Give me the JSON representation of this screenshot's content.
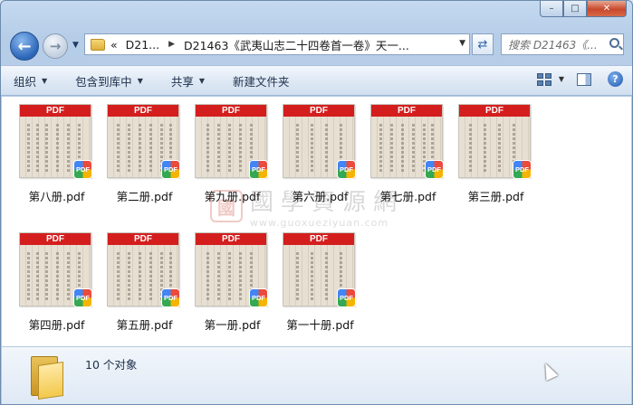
{
  "window": {
    "caption": {
      "minimize": "–",
      "maximize": "□",
      "close": "✕"
    }
  },
  "nav": {
    "address": {
      "overflow": "«",
      "crumbs": [
        "D21...",
        "D21463《武夷山志二十四卷首一卷》天一..."
      ]
    },
    "search_placeholder": "搜索 D21463《..."
  },
  "toolbar": {
    "organize": "组织",
    "include_in_library": "包含到库中",
    "share": "共享",
    "new_folder": "新建文件夹"
  },
  "files": [
    {
      "name": "第八册.pdf",
      "badge": "PDF"
    },
    {
      "name": "第二册.pdf",
      "badge": "PDF"
    },
    {
      "name": "第九册.pdf",
      "badge": "PDF"
    },
    {
      "name": "第六册.pdf",
      "badge": "PDF"
    },
    {
      "name": "第七册.pdf",
      "badge": "PDF"
    },
    {
      "name": "第三册.pdf",
      "badge": "PDF"
    },
    {
      "name": "第四册.pdf",
      "badge": "PDF"
    },
    {
      "name": "第五册.pdf",
      "badge": "PDF"
    },
    {
      "name": "第一册.pdf",
      "badge": "PDF"
    },
    {
      "name": "第一十册.pdf",
      "badge": "PDF"
    }
  ],
  "thumb_label": "PDF",
  "watermark": {
    "cn": "國學資源網",
    "en": "www.guoxueziyuan.com",
    "seal": "國"
  },
  "status": {
    "count": "10 个对象"
  },
  "colors": {
    "pdf_band": "#d41e1e",
    "window_frame": "#b6cde8"
  }
}
